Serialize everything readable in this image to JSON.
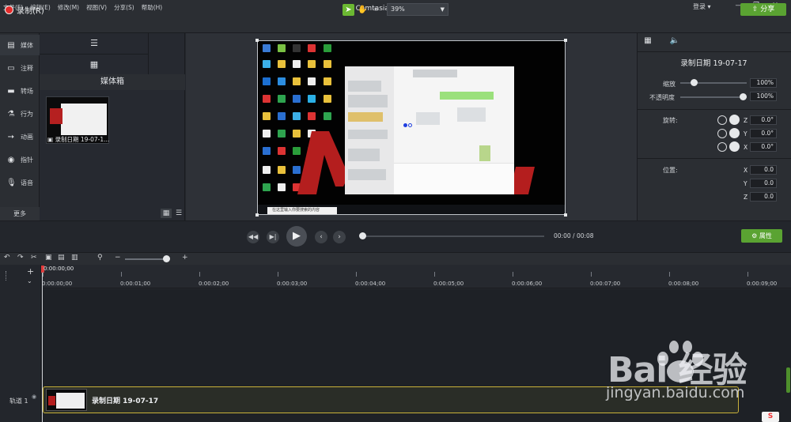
{
  "window": {
    "title": "Camtasia - 未命名项目*",
    "menus": [
      "文件(F)",
      "编辑(E)",
      "修改(M)",
      "视图(V)",
      "分享(S)",
      "帮助(H)"
    ],
    "login_label": "登录 ▾"
  },
  "toolbar": {
    "record_label": "录制(R)",
    "zoom_value": "39%",
    "share_label": "分享"
  },
  "left_tabs": [
    {
      "label": "媒体",
      "icon": "media-icon"
    },
    {
      "label": "注释",
      "icon": "annotation-icon"
    },
    {
      "label": "转场",
      "icon": "transition-icon"
    },
    {
      "label": "行为",
      "icon": "behavior-icon"
    },
    {
      "label": "动画",
      "icon": "animation-icon"
    },
    {
      "label": "指针",
      "icon": "cursor-icon"
    },
    {
      "label": "语音",
      "icon": "microphone-icon"
    }
  ],
  "more_label": "更多",
  "media_bin": {
    "title": "媒体箱",
    "items": [
      {
        "label": "录制日期 19-07-1..."
      }
    ]
  },
  "canvas": {
    "taskbar_search": "在这里输入你要搜索的内容"
  },
  "properties": {
    "title": "录制日期 19-07-17",
    "scale_label": "缩放",
    "scale_value": "100%",
    "scale_level": 1.0,
    "opacity_label": "不透明度",
    "opacity_value": "100%",
    "opacity_level": 1.0,
    "rotation_label": "旋转:",
    "rotation": [
      {
        "axis": "Z",
        "value": "0.0°"
      },
      {
        "axis": "Y",
        "value": "0.0°"
      },
      {
        "axis": "X",
        "value": "0.0°"
      }
    ],
    "position_label": "位置:",
    "position": [
      {
        "axis": "X",
        "value": "0.0"
      },
      {
        "axis": "Y",
        "value": "0.0"
      },
      {
        "axis": "Z",
        "value": "0.0"
      }
    ]
  },
  "transport": {
    "current_time": "00:00",
    "separator": "/",
    "total_time": "00:08",
    "properties_label": "属性"
  },
  "timeline": {
    "playhead_time": "0:00:00;00",
    "ticks": [
      "0:00:00;00",
      "0:00:01;00",
      "0:00:02;00",
      "0:00:03;00",
      "0:00:04;00",
      "0:00:05;00",
      "0:00:06;00",
      "0:00:07;00",
      "0:00:08;00",
      "0:00:09;00"
    ],
    "track_label": "轨道 1",
    "clip_label": "录制日期 19-07-17"
  },
  "watermark": {
    "logo": "Bai 经验",
    "url": "jingyan.baidu.com"
  },
  "colors": {
    "accent_green": "#5aa332",
    "record_red": "#e52b2b",
    "clip_border": "#c8b13a"
  }
}
